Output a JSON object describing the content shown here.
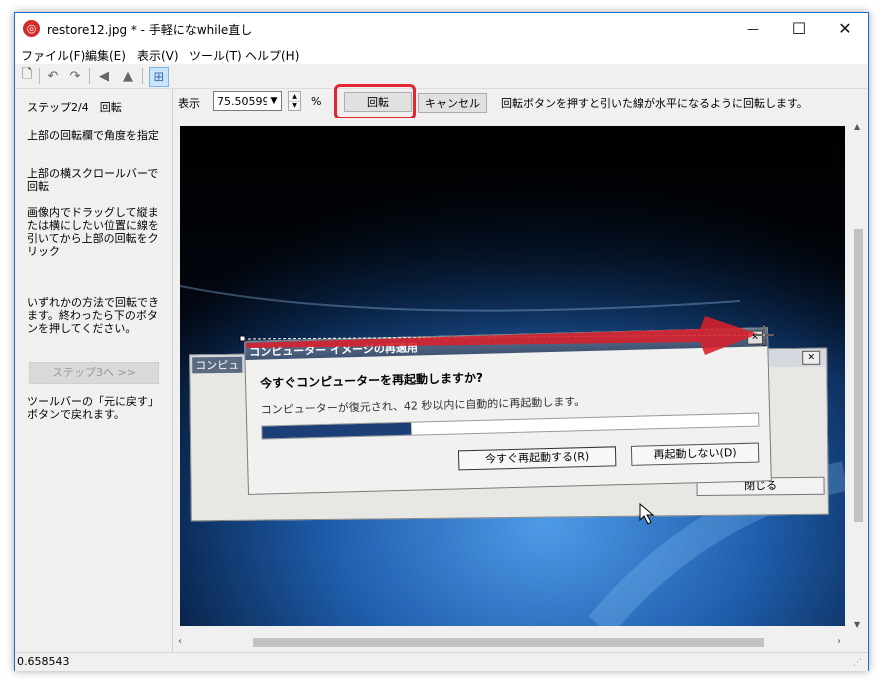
{
  "window": {
    "title": "restore12.jpg * - 手軽になwhile直し",
    "app_icon_glyph": "◎",
    "minimize_glyph": "—",
    "maximize_glyph": "☐",
    "close_glyph": "✕"
  },
  "menu": [
    "ファイル(F)",
    "編集(E)",
    "表示(V)",
    "ツール(T)",
    "ヘルプ(H)"
  ],
  "toolbar": {
    "new_glyph": "🗋",
    "undo_glyph": "↶",
    "redo_glyph": "↷",
    "flip_h_glyph": "◀",
    "flip_v_glyph": "▲",
    "grid_glyph": "⊞"
  },
  "left_panel": {
    "step_title": "ステップ2/4　回転",
    "instruction_1": "上部の回転欄で角度を指定",
    "instruction_2": "上部の横スクロールバーで回転",
    "instruction_3": "画像内でドラッグして縦または横にしたい位置に線を引いてから上部の回転をクリック",
    "instruction_4": "いずれかの方法で回転できます。終わったら下のボタンを押してください。",
    "next_button": "ステップ3へ >>",
    "undo_note": "ツールバーの「元に戻す」ボタンで戻れます。"
  },
  "controls": {
    "zoom_label": "表示",
    "zoom_value": "75.505991",
    "percent": "%",
    "rotate_button": "回転",
    "cancel_button": "キャンセル",
    "hint": "回転ボタンを押すと引いた線が水平になるように回転します。"
  },
  "photo": {
    "dialog_title": "コンピューター イメージの再適用",
    "question": "今すぐコンピューターを再起動しますか?",
    "message": "コンピューターが復元され、42 秒以内に自動的に再起動します。",
    "progress": 0.3,
    "restart_now": "今すぐ再起動する(R)",
    "dont_restart": "再起動しない(D)",
    "close_button": "閉じる",
    "back_window_title": "コンピュ",
    "close_x": "✕"
  },
  "statusbar": {
    "value": "0.658543"
  }
}
